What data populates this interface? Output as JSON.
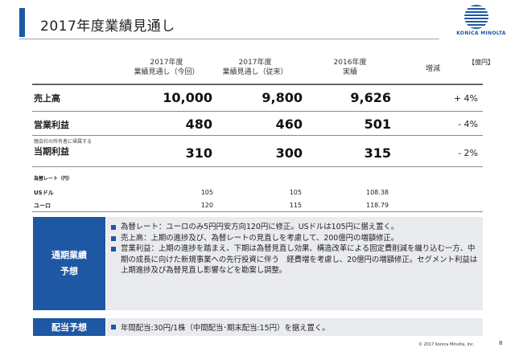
{
  "header": {
    "title": "2017年度業績見通し"
  },
  "logo": {
    "text": "KONICA MINOLTA"
  },
  "table": {
    "unit": "【億円】",
    "columns": [
      {
        "line1": "2017年度",
        "line2": "業績見通し（今回）"
      },
      {
        "line1": "2017年度",
        "line2": "業績見通し（従来）"
      },
      {
        "line1": "2016年度",
        "line2": "実績"
      },
      {
        "line1": "増減",
        "line2": ""
      }
    ],
    "rows": [
      {
        "label": "売上高",
        "sublabel": "",
        "values": [
          "10,000",
          "9,800",
          "9,626"
        ],
        "change": "+ 4%"
      },
      {
        "label": "営業利益",
        "sublabel": "",
        "values": [
          "480",
          "460",
          "501"
        ],
        "change": "- 4%"
      },
      {
        "label": "当期利益",
        "sublabel": "親会社の所有者に帰属する",
        "values": [
          "310",
          "300",
          "315"
        ],
        "change": "- 2%"
      }
    ],
    "fx": {
      "title": "為替レート（円）",
      "rows": [
        {
          "label": "USドル",
          "values": [
            "105",
            "105",
            "108.38"
          ]
        },
        {
          "label": "ユーロ",
          "values": [
            "120",
            "115",
            "118.79"
          ]
        }
      ]
    }
  },
  "outlook": {
    "label_line1": "通期業績",
    "label_line2": "予想",
    "bullets": [
      "為替レート：ユーロのみ5円円安方向120円に修正。USドルは105円に据え置く。",
      "売上高：上期の進捗及び、為替レートの見直しを考慮して、200億円の増額修正。",
      "営業利益：上期の進捗を踏まえ、下期は為替見直し効果、構造改革による固定費削減を織り込む一方、中期の成長に向けた新規事業への先行投資に伴う　経費増を考慮し、20億円の増額修正。セグメント利益は上期進捗及び為替見直し影響などを勘案し調整。"
    ]
  },
  "dividend": {
    "label": "配当予想",
    "text": "年間配当:30円/1株（中間配当･期末配当:15円）を据え置く。"
  },
  "footer": {
    "copyright": "© 2017 Konica Minolta, Inc.",
    "page": "8"
  }
}
